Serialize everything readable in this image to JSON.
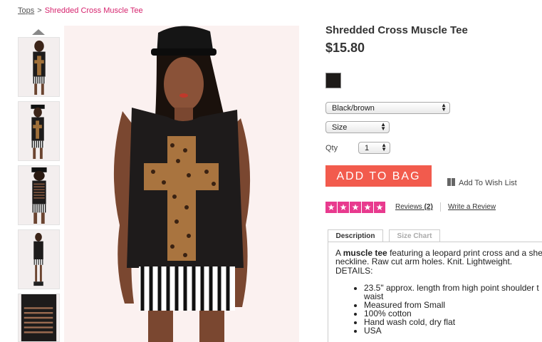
{
  "breadcrumb": {
    "parent": "Tops",
    "separator": ">",
    "current": "Shredded Cross Muscle Tee"
  },
  "product": {
    "title": "Shredded Cross Muscle Tee",
    "price": "$15.80",
    "swatch_color": "#1e1b19"
  },
  "options": {
    "color_value": "Black/brown",
    "size_value": "Size",
    "qty_label": "Qty",
    "qty_value": "1"
  },
  "actions": {
    "add_to_bag": "ADD TO BAG",
    "wish_list": "Add To Wish List"
  },
  "rating": {
    "stars": 5,
    "reviews_label": "Reviews",
    "reviews_count": "(2)",
    "write_review": "Write a Review"
  },
  "tabs": [
    {
      "label": "Description",
      "active": true
    },
    {
      "label": "Size Chart",
      "active": false
    }
  ],
  "description": {
    "intro_prefix": "A ",
    "intro_bold": "muscle tee",
    "intro_rest": " featuring a leopard print cross and a she",
    "line2": "neckline. Raw cut arm holes. Knit. Lightweight.",
    "details_heading": "DETAILS:",
    "specs": [
      "23.5\" approx. length from high point shoulder t",
      "waist",
      "Measured from Small",
      "100% cotton",
      "Hand wash cold, dry flat",
      "USA"
    ]
  },
  "colors": {
    "accent_pink": "#d6246e",
    "button": "#f25b4d",
    "stars": "#e83a8e"
  }
}
